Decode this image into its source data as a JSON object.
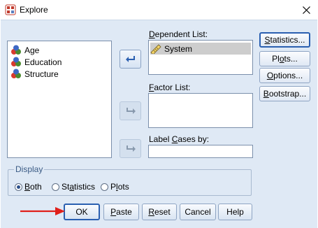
{
  "window": {
    "title": "Explore"
  },
  "variables": [
    {
      "label": "Age",
      "icon": "nominal-variable-icon"
    },
    {
      "label": "Education",
      "icon": "nominal-variable-icon"
    },
    {
      "label": "Structure",
      "icon": "nominal-variable-icon"
    }
  ],
  "dependent": {
    "label_pre": "",
    "label_ul": "D",
    "label_post": "ependent List:",
    "items": [
      "System"
    ]
  },
  "factor": {
    "label_pre": "",
    "label_ul": "F",
    "label_post": "actor List:"
  },
  "label_cases": {
    "label_pre": "Label ",
    "label_ul": "C",
    "label_post": "ases by:",
    "value": ""
  },
  "side_buttons": [
    {
      "pre": "",
      "ul": "S",
      "post": "tatistics...",
      "focused": true
    },
    {
      "pre": "Pl",
      "ul": "o",
      "post": "ts...",
      "focused": false
    },
    {
      "pre": "",
      "ul": "O",
      "post": "ptions...",
      "focused": false
    },
    {
      "pre": "",
      "ul": "B",
      "post": "ootstrap...",
      "focused": false
    }
  ],
  "display": {
    "title": "Display",
    "options": [
      {
        "pre": "",
        "ul": "B",
        "post": "oth",
        "selected": true
      },
      {
        "pre": "St",
        "ul": "a",
        "post": "tistics",
        "selected": false
      },
      {
        "pre": "P",
        "ul": "l",
        "post": "ots",
        "selected": false
      }
    ]
  },
  "bottom_buttons": [
    {
      "pre": "",
      "ul": "",
      "post": "OK",
      "default": true
    },
    {
      "pre": "",
      "ul": "P",
      "post": "aste",
      "default": false
    },
    {
      "pre": "",
      "ul": "R",
      "post": "eset",
      "default": false
    },
    {
      "pre": "",
      "ul": "",
      "post": "Cancel",
      "default": false
    },
    {
      "pre": "",
      "ul": "",
      "post": "Help",
      "default": false
    }
  ],
  "colors": {
    "accent": "#2a5fb0",
    "annotation_arrow": "#e0201b",
    "selection": "#cdcdcd"
  }
}
